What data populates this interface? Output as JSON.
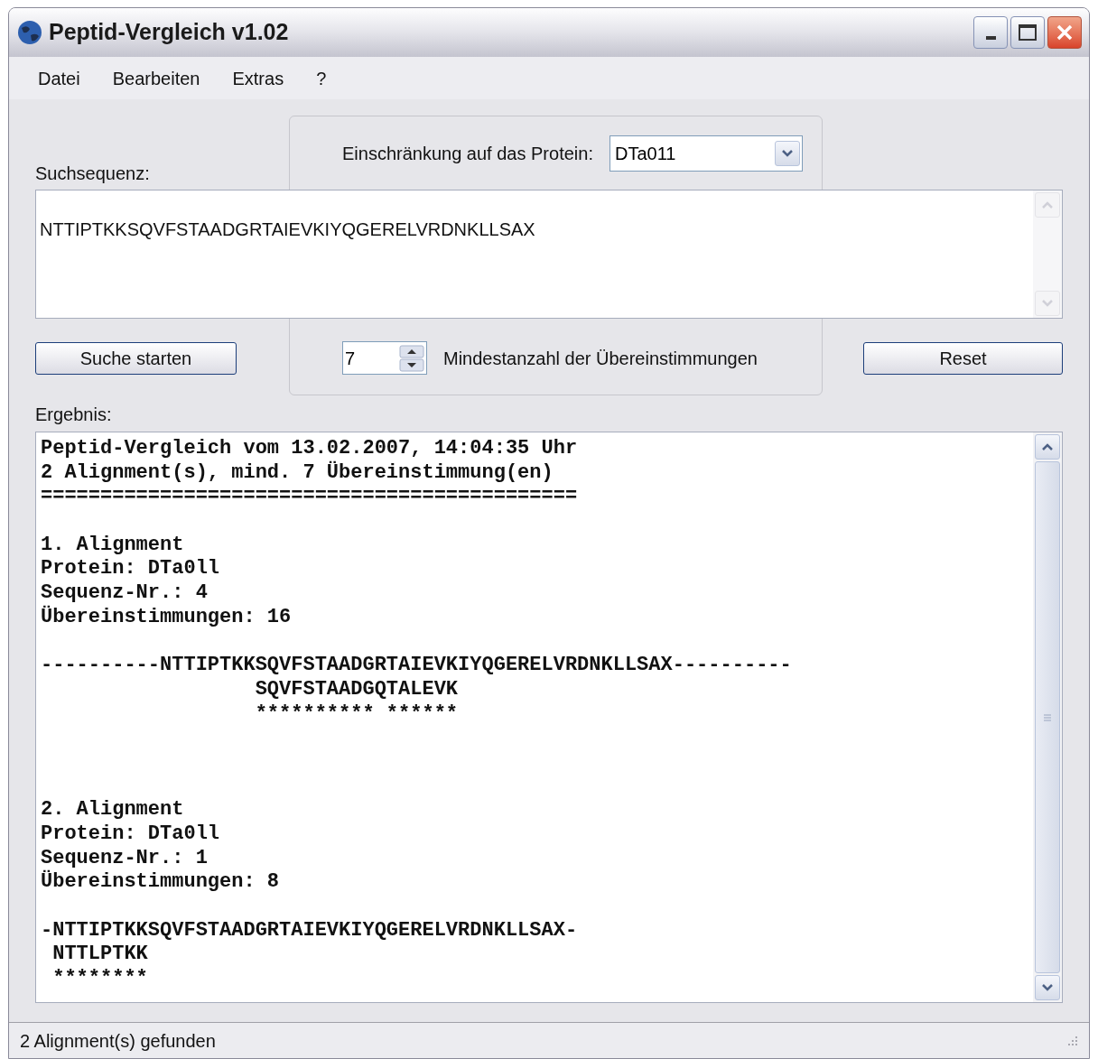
{
  "window": {
    "title": "Peptid-Vergleich v1.02"
  },
  "menu": [
    "Datei",
    "Bearbeiten",
    "Extras",
    "?"
  ],
  "protein_filter": {
    "label": "Einschränkung auf das Protein:",
    "value": "DTa011"
  },
  "search": {
    "label": "Suchsequenz:",
    "value": "NTTIPTKKSQVFSTAADGRTAIEVKIYQGERELVRDNKLLSAX"
  },
  "start_button": "Suche starten",
  "min_matches": {
    "value": "7",
    "label": "Mindestanzahl der Übereinstimmungen"
  },
  "reset_button": "Reset",
  "result": {
    "label": "Ergebnis:",
    "header": [
      "Peptid-Vergleich vom 13.02.2007, 14:04:35 Uhr",
      "2 Alignment(s), mind. 7 Übereinstimmung(en)",
      "============================================="
    ],
    "alignments": [
      {
        "info": [
          "1. Alignment",
          "Protein: DTa0ll",
          "Sequenz-Nr.: 4",
          "Übereinstimmungen: 16"
        ],
        "lines": [
          "----------NTTIPTKKSQVFSTAADGRTAIEVKIYQGERELVRDNKLLSAX----------",
          "                  SQVFSTAADGQTALEVK",
          "                  ********** ******"
        ]
      },
      {
        "info": [
          "2. Alignment",
          "Protein: DTa0ll",
          "Sequenz-Nr.: 1",
          "Übereinstimmungen: 8"
        ],
        "lines": [
          "-NTTIPTKKSQVFSTAADGRTAIEVKIYQGERELVRDNKLLSAX-",
          " NTTLPTKK",
          " ********"
        ]
      }
    ]
  },
  "status_bar": "2 Alignment(s) gefunden"
}
